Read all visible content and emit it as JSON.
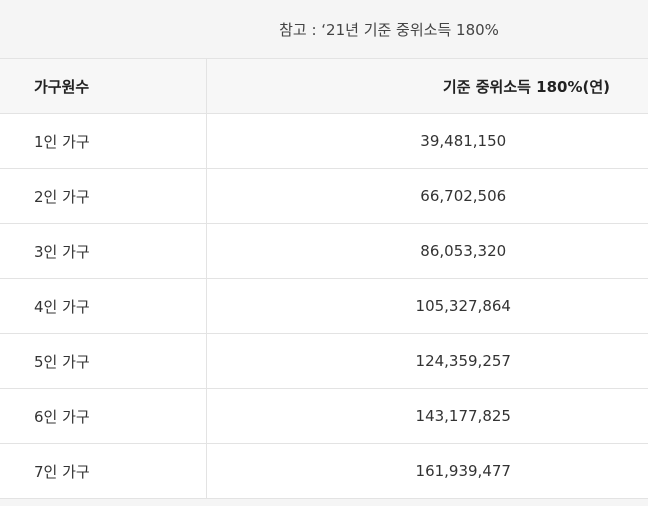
{
  "note": "참고 : ‘21년 기준 중위소득 180%",
  "table": {
    "headers": [
      "가구원수",
      "기준 중위소득 180%(연)"
    ],
    "rows": [
      {
        "household": "1인 가구",
        "income": "39,481,150"
      },
      {
        "household": "2인 가구",
        "income": "66,702,506"
      },
      {
        "household": "3인 가구",
        "income": "86,053,320"
      },
      {
        "household": "4인 가구",
        "income": "105,327,864"
      },
      {
        "household": "5인 가구",
        "income": "124,359,257"
      },
      {
        "household": "6인 가구",
        "income": "143,177,825"
      },
      {
        "household": "7인 가구",
        "income": "161,939,477"
      }
    ]
  }
}
